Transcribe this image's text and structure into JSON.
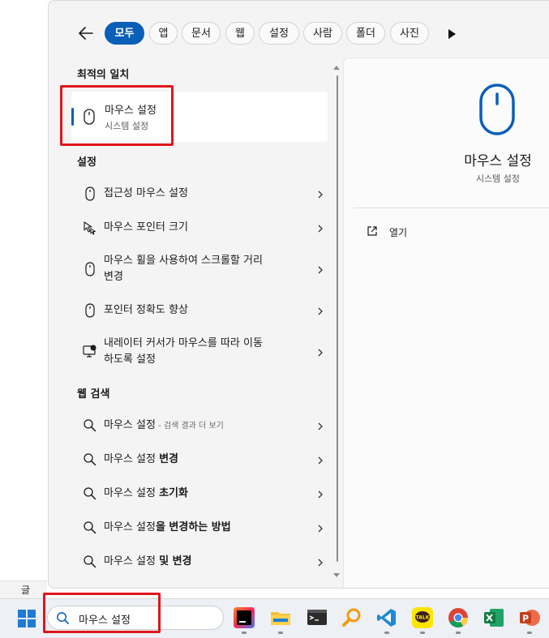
{
  "filters": {
    "chips": [
      {
        "label": "모두"
      },
      {
        "label": "앱"
      },
      {
        "label": "문서"
      },
      {
        "label": "웹"
      },
      {
        "label": "설정"
      },
      {
        "label": "사람"
      },
      {
        "label": "폴더"
      },
      {
        "label": "사진"
      }
    ]
  },
  "best_match": {
    "section": "최적의 일치",
    "title": "마우스 설정",
    "subtitle": "시스템 설정"
  },
  "settings": {
    "section": "설정",
    "items": [
      {
        "line1": "접근성 마우스 설정"
      },
      {
        "line1": "마우스 포인터 크기"
      },
      {
        "line1": "마우스 휠을 사용하여 스크롤할 거리",
        "line2": "변경"
      },
      {
        "line1": "포인터 정확도 향상"
      },
      {
        "line1": "내레이터 커서가 마우스를 따라 이동",
        "line2": "하도록 설정"
      }
    ]
  },
  "web": {
    "section": "웹 검색",
    "items": [
      {
        "base": "마우스 설정",
        "bold": "",
        "hint": " - 검색 결과 더 보기"
      },
      {
        "base": "마우스 설정 ",
        "bold": "변경",
        "hint": ""
      },
      {
        "base": "마우스 설정 ",
        "bold": "초기화",
        "hint": ""
      },
      {
        "base": "마우스 설정",
        "bold": "을 변경하는 방법",
        "hint": ""
      },
      {
        "base": "마우스 설정 ",
        "bold": "및 변경",
        "hint": ""
      }
    ]
  },
  "detail": {
    "title": "마우스 설정",
    "subtitle": "시스템 설정",
    "open_label": "열기"
  },
  "taskbar": {
    "search_value": "마우스 설정"
  },
  "desktop": {
    "strip_text": "글"
  },
  "colors": {
    "accent": "#0a5fb8",
    "highlight": "#e0161e"
  }
}
